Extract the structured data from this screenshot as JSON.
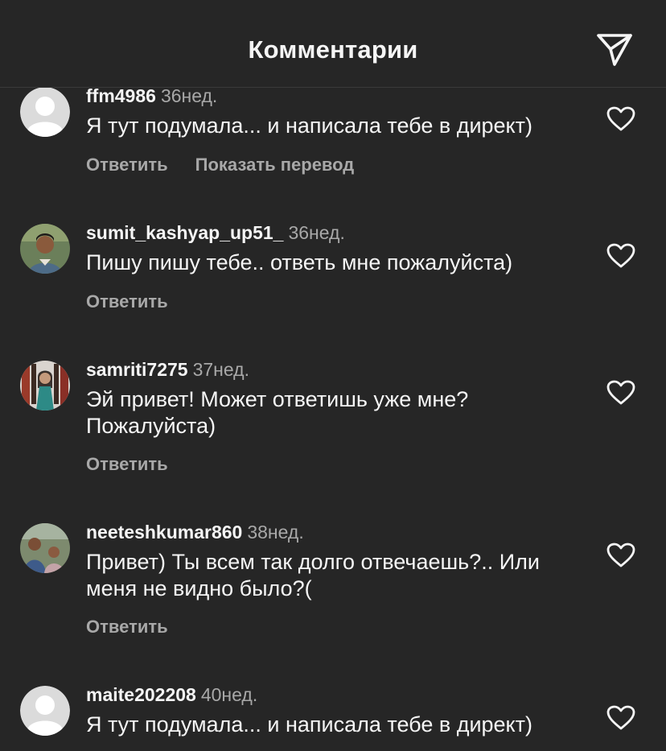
{
  "header": {
    "title": "Комментарии",
    "share_icon": "paper-plane-icon"
  },
  "comments": [
    {
      "username": "ffm4986",
      "time": "36нед.",
      "text": "Я тут подумала... и написала тебе в директ)",
      "reply_label": "Ответить",
      "translate_label": "Показать перевод",
      "avatar": "default-avatar"
    },
    {
      "username": "sumit_kashyap_up51_",
      "time": "36нед.",
      "text": "Пишу пишу тебе.. ответь мне пожалуйста)",
      "reply_label": "Ответить",
      "avatar": "photo-avatar"
    },
    {
      "username": "samriti7275",
      "time": "37нед.",
      "text": "Эй привет! Может ответишь уже мне? Пожалуйста)",
      "reply_label": "Ответить",
      "avatar": "photo-avatar"
    },
    {
      "username": "neeteshkumar860",
      "time": "38нед.",
      "text": "Привет) Ты всем так долго отвечаешь?.. Или меня не видно было?(",
      "reply_label": "Ответить",
      "avatar": "photo-avatar"
    },
    {
      "username": "maite202208",
      "time": "40нед.",
      "text": "Я тут подумала... и написала тебе в директ)",
      "avatar": "default-avatar"
    }
  ],
  "colors": {
    "background": "#262626",
    "primary_text": "#f5f5f5",
    "secondary_text": "#a8a8a8"
  }
}
